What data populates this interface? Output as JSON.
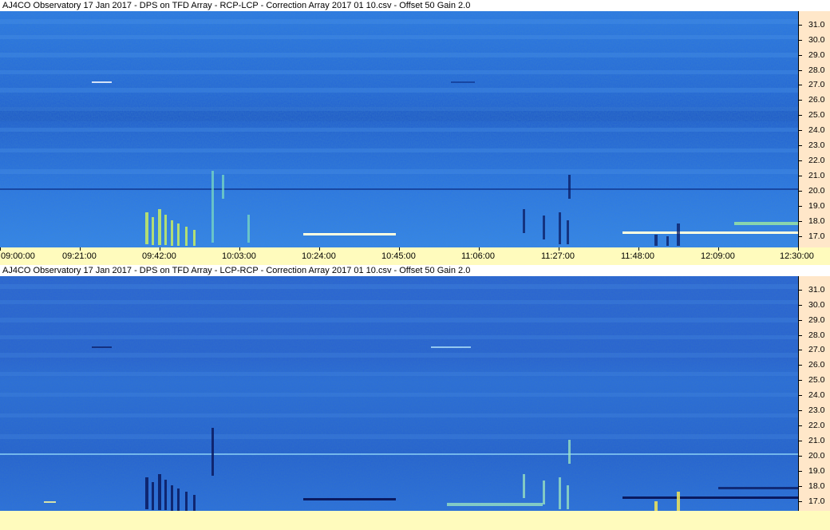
{
  "panels": [
    {
      "title": "AJ4CO Observatory 17 Jan 2017  -  DPS on TFD Array  -  RCP-LCP  -  Correction Array 2017 01 10.csv  -  Offset 50  Gain 2.0",
      "mode": "RCP-LCP"
    },
    {
      "title": "AJ4CO Observatory 17 Jan 2017  -  DPS on TFD Array  -  LCP-RCP  -  Correction Array 2017 01 10.csv  -  Offset 50  Gain 2.0",
      "mode": "LCP-RCP"
    }
  ],
  "frequency_axis": {
    "labels": [
      "31.0",
      "30.0",
      "29.0",
      "28.0",
      "27.0",
      "26.0",
      "25.0",
      "24.0",
      "23.0",
      "22.0",
      "21.0",
      "20.0",
      "19.0",
      "18.0",
      "17.0"
    ]
  },
  "time_axis": {
    "labels": [
      "09:00:00",
      "09:21:00",
      "09:42:00",
      "10:03:00",
      "10:24:00",
      "10:45:00",
      "11:06:00",
      "11:27:00",
      "11:48:00",
      "12:09:00",
      "12:30:00"
    ]
  },
  "colors": {
    "background_blue": "#2a6be0",
    "axis_panel": "#ffe7c9",
    "time_bar": "#fffbbd",
    "burst_bright": "#d8f070",
    "burst_dark": "#0a1a60"
  }
}
